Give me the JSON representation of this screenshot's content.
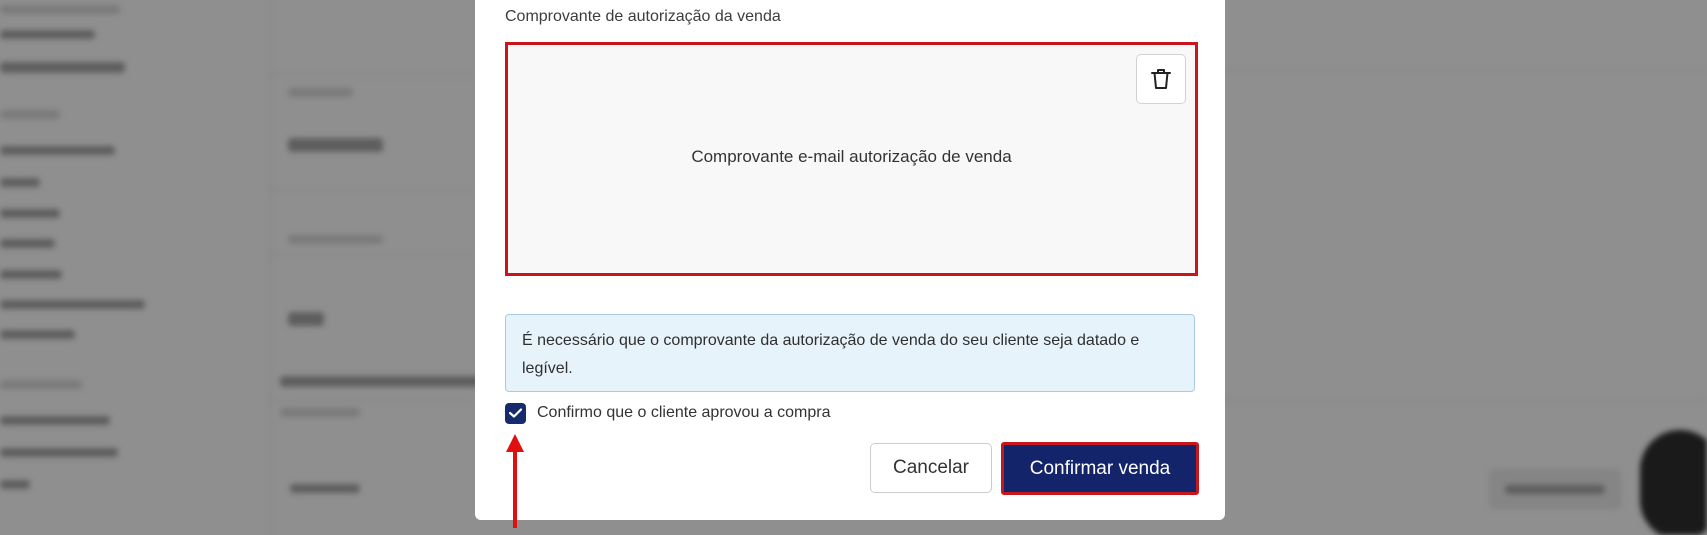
{
  "modal": {
    "field_label": "Comprovante de autorização da venda",
    "upload_filename": "Comprovante e-mail autorização de venda",
    "delete_icon": "trash-icon",
    "info_text": "É necessário que o comprovante da autorização de venda do seu cliente seja datado e legível.",
    "confirm_checkbox": {
      "checked": true,
      "label": "Confirmo que o cliente aprovou a compra"
    },
    "cancel_label": "Cancelar",
    "confirm_label": "Confirmar venda"
  },
  "colors": {
    "primary": "#13246b",
    "highlight_red": "#c8161d",
    "info_bg": "#e6f3fb",
    "overlay": "#8f8f8f"
  }
}
